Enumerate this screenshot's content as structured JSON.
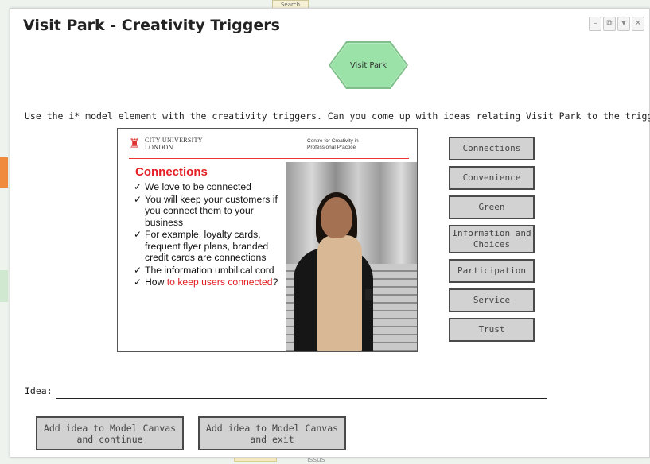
{
  "background": {
    "tab_label": "Search",
    "bottom_text": "Issus"
  },
  "dialog": {
    "title": "Visit Park - Creativity Triggers",
    "controls": [
      "–",
      "⧉",
      "▾",
      "✕"
    ],
    "element_label": "Visit Park",
    "instruction": "Use the i* model element with the creativity triggers. Can you come up with ideas relating Visit Park to the trigger?",
    "slide": {
      "university": "CITY UNIVERSITY\nLONDON",
      "centre": "Centre for Creativity in Professional Practice",
      "heading": "Connections",
      "bullets": [
        "We love to be connected",
        "You will keep your customers if you connect them to your business",
        "For example, loyalty cards, frequent flyer plans, branded credit cards are connections",
        "The information umbilical cord"
      ],
      "last_bullet_prefix": "How ",
      "last_bullet_highlight": "to keep users connected",
      "last_bullet_suffix": "?"
    },
    "triggers": [
      "Connections",
      "Convenience",
      "Green",
      "Information and Choices",
      "Participation",
      "Service",
      "Trust"
    ],
    "idea_label": "Idea:",
    "idea_value": "",
    "buttons": {
      "continue": "Add idea to Model Canvas\nand continue",
      "exit": "Add idea to Model Canvas\nand exit"
    }
  },
  "colors": {
    "element_green": "#9be2a9",
    "slide_red": "#e31e24",
    "button_gray": "#d2d2d2"
  }
}
